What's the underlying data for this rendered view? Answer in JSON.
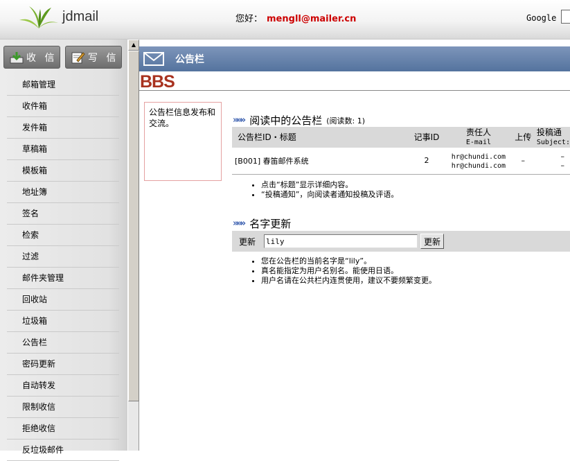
{
  "header": {
    "app_name": "jdmail",
    "greeting": "您好：",
    "user_email": "mengll@mailer.cn",
    "search_label": "Google"
  },
  "sidebar": {
    "inbox_button": "收 信",
    "compose_button": "写 信",
    "items": [
      {
        "label": "邮箱管理"
      },
      {
        "label": "收件箱"
      },
      {
        "label": "发件箱"
      },
      {
        "label": "草稿箱"
      },
      {
        "label": "模板箱"
      },
      {
        "label": "地址簿"
      },
      {
        "label": "签名"
      },
      {
        "label": "检索"
      },
      {
        "label": "过滤"
      },
      {
        "label": "邮件夹管理"
      },
      {
        "label": "回收站"
      },
      {
        "label": "垃圾箱"
      },
      {
        "label": "公告栏"
      },
      {
        "label": "密码更新"
      },
      {
        "label": "自动转发"
      },
      {
        "label": "限制收信"
      },
      {
        "label": "拒绝收信"
      },
      {
        "label": "反垃圾邮件"
      }
    ]
  },
  "main": {
    "title": "公告栏",
    "banner": "BBS",
    "info_box": "公告栏信息发布和交流。",
    "reading_section": {
      "title": "阅读中的公告栏",
      "read_count": "(阅读数: 1)",
      "columns": {
        "id_title": "公告栏ID・标题",
        "post_id": "记事ID",
        "owner": "责任人",
        "owner_sub": "E-mail",
        "upload": "上传",
        "contribute": "投稿通",
        "contribute_sub": "Subject:"
      },
      "rows": [
        {
          "id_title": "[B001] 春笛邮件系统",
          "post_id": "2",
          "owner_email_1": "hr@chundi.com",
          "owner_email_2": "hr@chundi.com",
          "upload": "–",
          "contribute_1": "–",
          "contribute_2": "–"
        }
      ],
      "notes": [
        "点击“标题”显示详细内容。",
        "“投稿通知”，向阅读者通知投稿及评语。"
      ]
    },
    "name_section": {
      "title": "名字更新",
      "label": "更新",
      "input_value": "lily",
      "button": "更新",
      "notes": [
        "您在公告栏的当前名字是“lily”。",
        "真名能指定为用户名别名。能使用日语。",
        "用户名请在公共栏内连贯使用，建议不要频繁变更。"
      ]
    }
  },
  "colors": {
    "title_bar": "#6b86ad",
    "user_email": "#cc0000",
    "bbs_logo": "#a8321f",
    "arrows": "#3a5fb0"
  }
}
